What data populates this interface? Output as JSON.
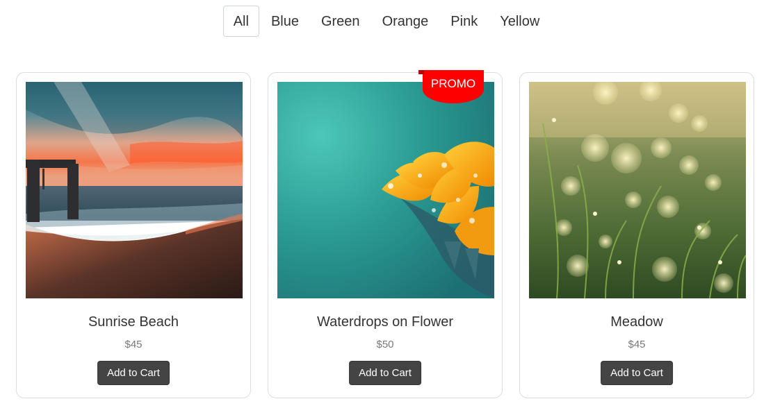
{
  "filters": {
    "items": [
      "All",
      "Blue",
      "Green",
      "Orange",
      "Pink",
      "Yellow"
    ],
    "active": "All"
  },
  "products": [
    {
      "title": "Sunrise Beach",
      "price": "$45",
      "button": "Add to Cart",
      "promo": ""
    },
    {
      "title": "Waterdrops on Flower",
      "price": "$50",
      "button": "Add to Cart",
      "promo": "PROMO"
    },
    {
      "title": "Meadow",
      "price": "$45",
      "button": "Add to Cart",
      "promo": ""
    }
  ],
  "colors": {
    "button_bg": "#444444",
    "promo_bg": "#ff0000",
    "border": "#d9dde2"
  }
}
